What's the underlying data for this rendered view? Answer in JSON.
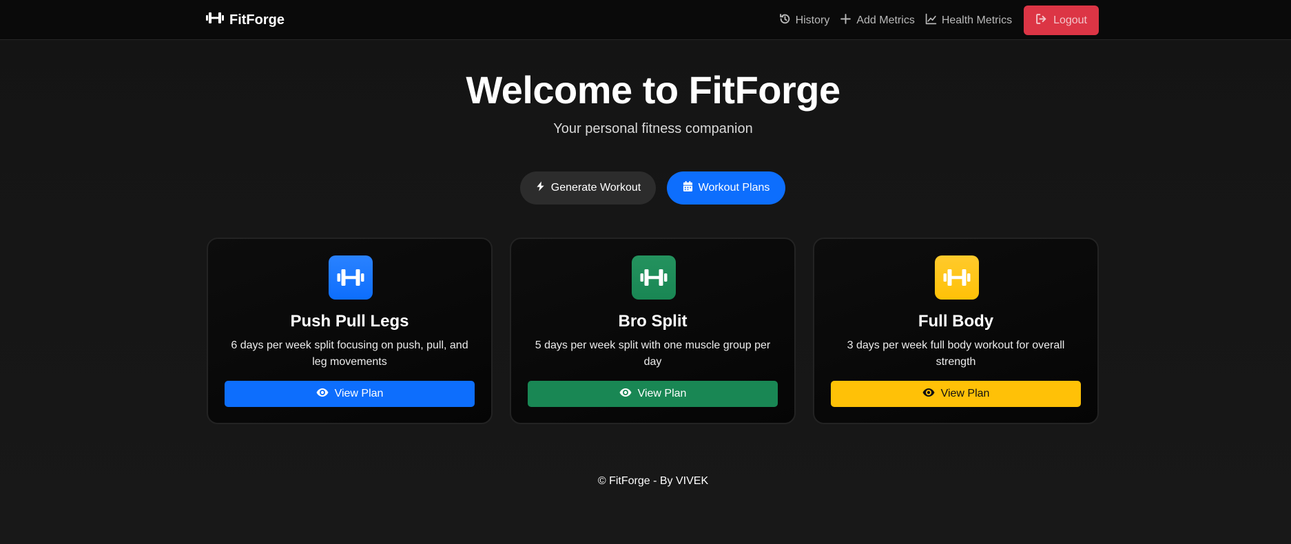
{
  "navbar": {
    "brand": "FitForge",
    "brand_icon": "dumbbell-icon",
    "links": [
      {
        "label": "History",
        "icon": "history-icon"
      },
      {
        "label": "Add Metrics",
        "icon": "plus-icon"
      },
      {
        "label": "Health Metrics",
        "icon": "chart-line-icon"
      }
    ],
    "logout": {
      "label": "Logout",
      "icon": "sign-out-icon",
      "color": "#dc3545"
    }
  },
  "hero": {
    "title": "Welcome to FitForge",
    "subtitle": "Your personal fitness companion"
  },
  "actions": {
    "generate": {
      "label": "Generate Workout",
      "icon": "bolt-icon",
      "color": "#2c2c2c"
    },
    "plans": {
      "label": "Workout Plans",
      "icon": "calendar-icon",
      "color": "#0d6efd"
    }
  },
  "plans": [
    {
      "title": "Push Pull Legs",
      "description": "6 days per week split focusing on push, pull, and leg movements",
      "button": "View Plan",
      "icon": "dumbbell-icon",
      "accent": "#0d6efd"
    },
    {
      "title": "Bro Split",
      "description": "5 days per week split with one muscle group per day",
      "button": "View Plan",
      "icon": "dumbbell-icon",
      "accent": "#198754"
    },
    {
      "title": "Full Body",
      "description": "3 days per week full body workout for overall strength",
      "button": "View Plan",
      "icon": "dumbbell-icon",
      "accent": "#ffc107"
    }
  ],
  "footer": "© FitForge - By VIVEK"
}
